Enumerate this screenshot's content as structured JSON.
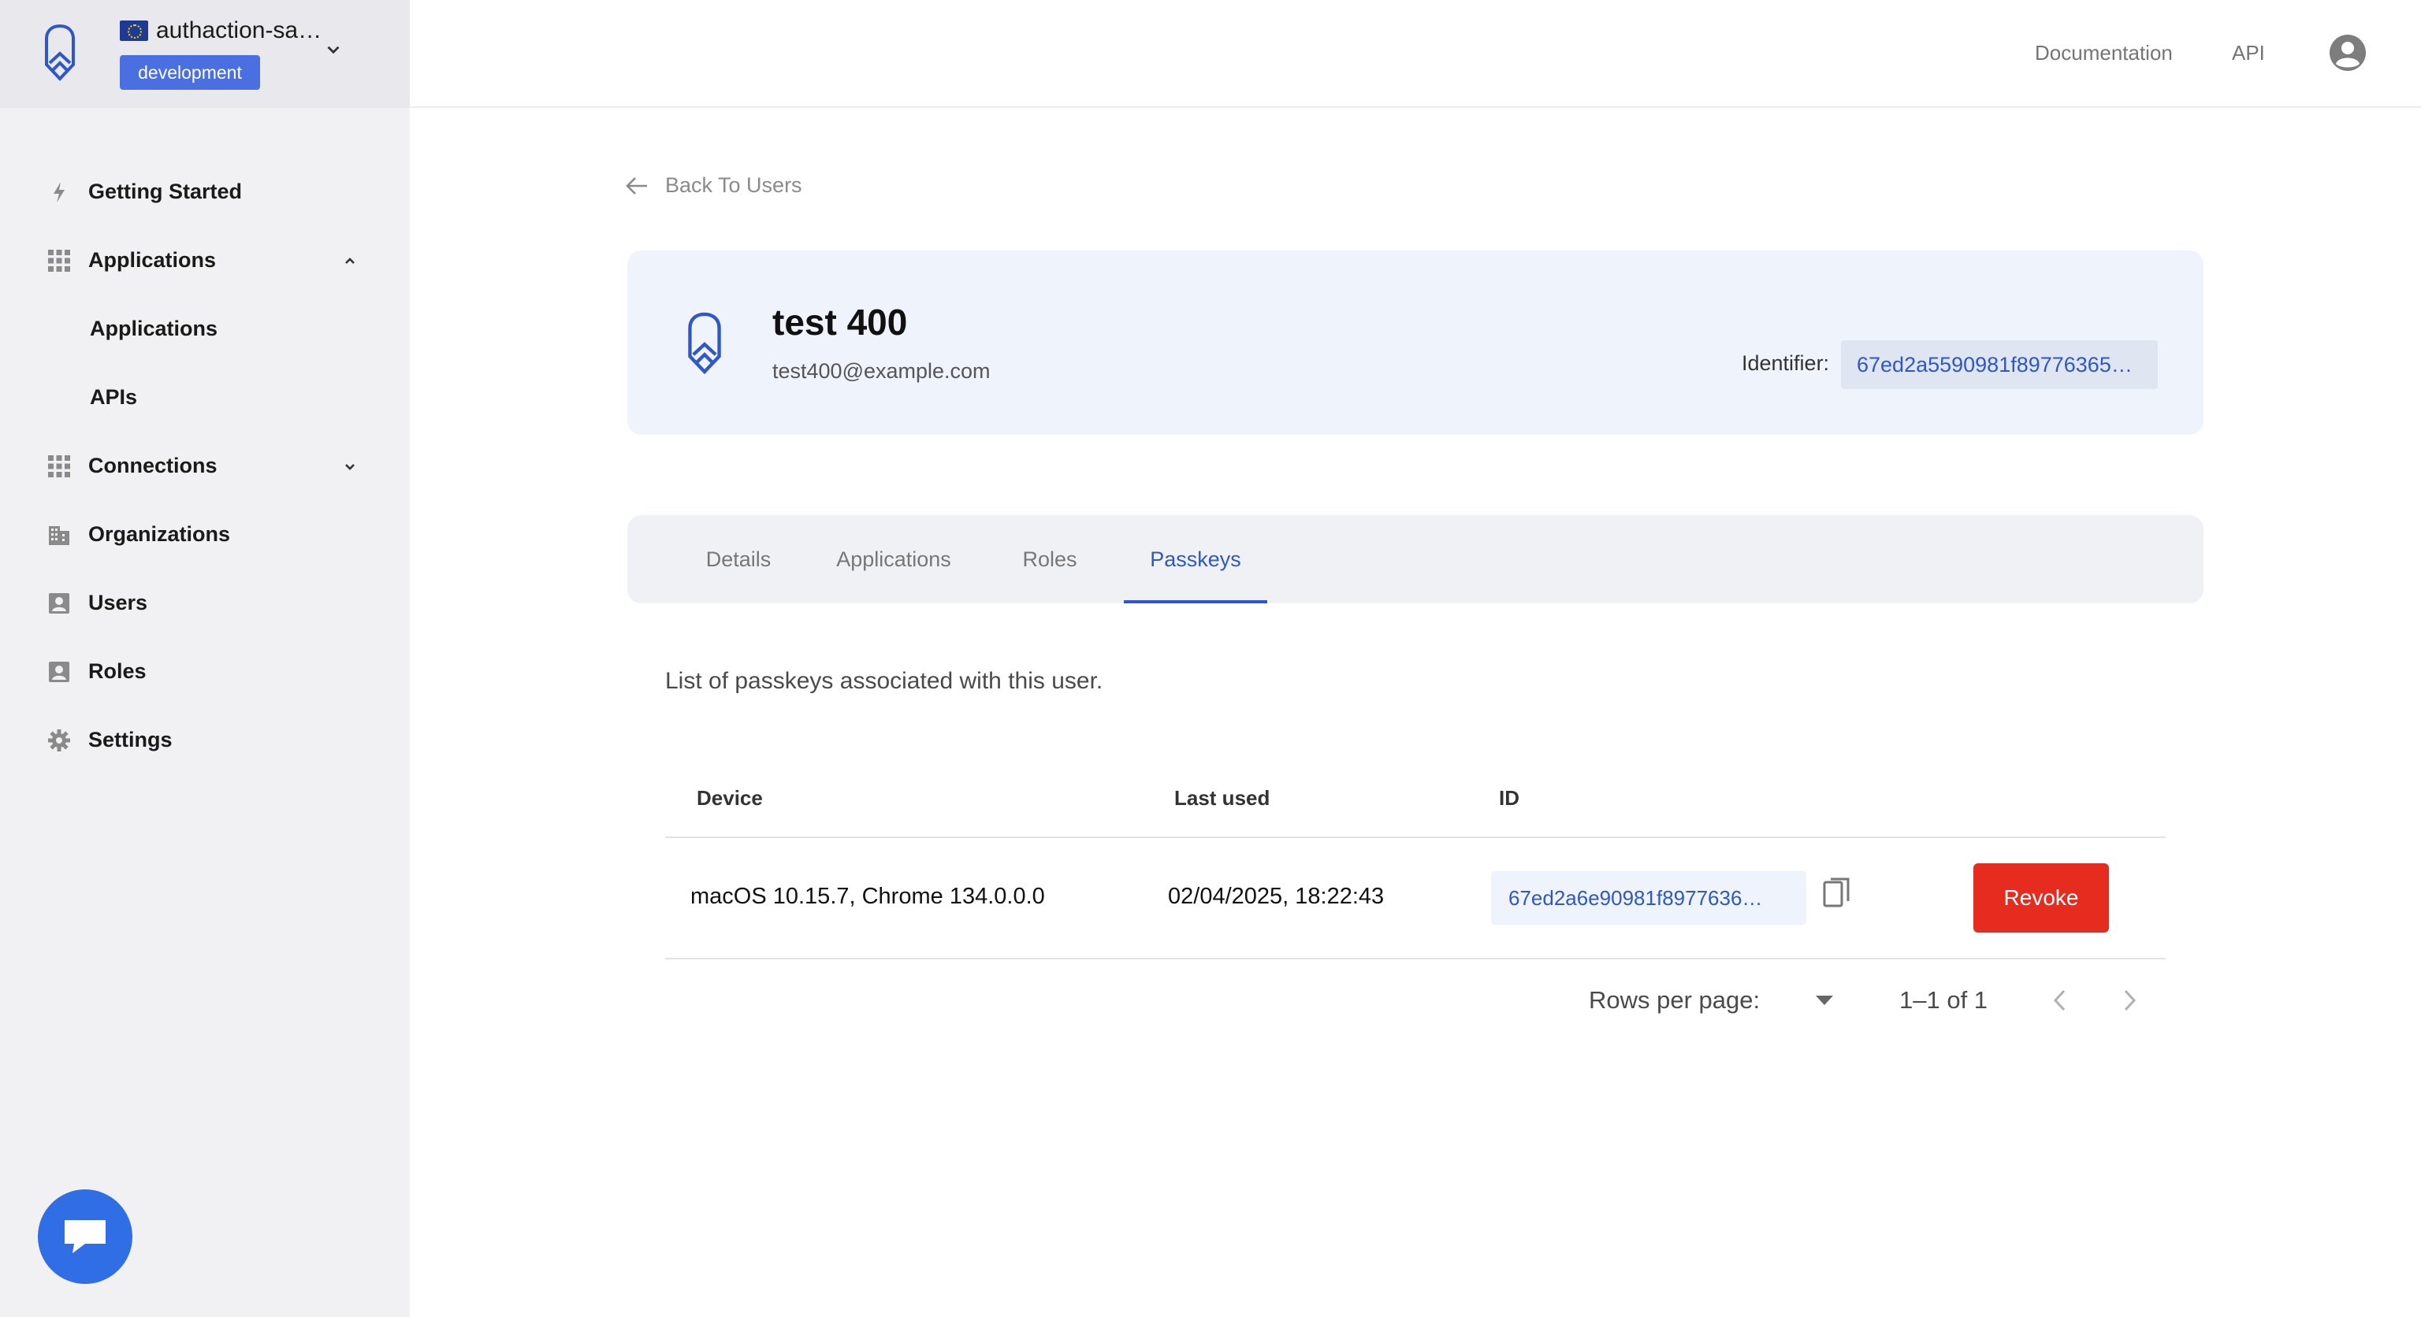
{
  "tenant": {
    "name": "authaction-sa…",
    "environment": "development"
  },
  "sidebar": {
    "items": [
      {
        "label": "Getting Started",
        "icon": "bolt-icon"
      },
      {
        "label": "Applications",
        "icon": "grid-icon",
        "expanded": true
      },
      {
        "label": "Applications",
        "sub": true
      },
      {
        "label": "APIs",
        "sub": true
      },
      {
        "label": "Connections",
        "icon": "grid-icon",
        "expanded": false
      },
      {
        "label": "Organizations",
        "icon": "building-icon"
      },
      {
        "label": "Users",
        "icon": "user-badge-icon"
      },
      {
        "label": "Roles",
        "icon": "user-badge-icon"
      },
      {
        "label": "Settings",
        "icon": "gear-icon"
      }
    ]
  },
  "topbar": {
    "documentation": "Documentation",
    "api": "API"
  },
  "back_label": "Back To Users",
  "user": {
    "name": "test 400",
    "email": "test400@example.com",
    "identifier_label": "Identifier:",
    "identifier_value": "67ed2a5590981f89776365…"
  },
  "tabs": [
    {
      "label": "Details",
      "active": false
    },
    {
      "label": "Applications",
      "active": false
    },
    {
      "label": "Roles",
      "active": false
    },
    {
      "label": "Passkeys",
      "active": true
    }
  ],
  "passkeys": {
    "intro": "List of passkeys associated with this user.",
    "columns": {
      "device": "Device",
      "last_used": "Last used",
      "id": "ID"
    },
    "rows": [
      {
        "device": "macOS 10.15.7, Chrome 134.0.0.0",
        "last_used": "02/04/2025, 18:22:43",
        "id": "67ed2a6e90981f8977636…",
        "action": "Revoke"
      }
    ],
    "pagination": {
      "rows_per_page_label": "Rows per page:",
      "range": "1–1 of 1"
    }
  },
  "colors": {
    "accent": "#2f57c5",
    "danger": "#e62b1f",
    "badge": "#4a6fe0",
    "card_bg": "#eff3fb"
  }
}
